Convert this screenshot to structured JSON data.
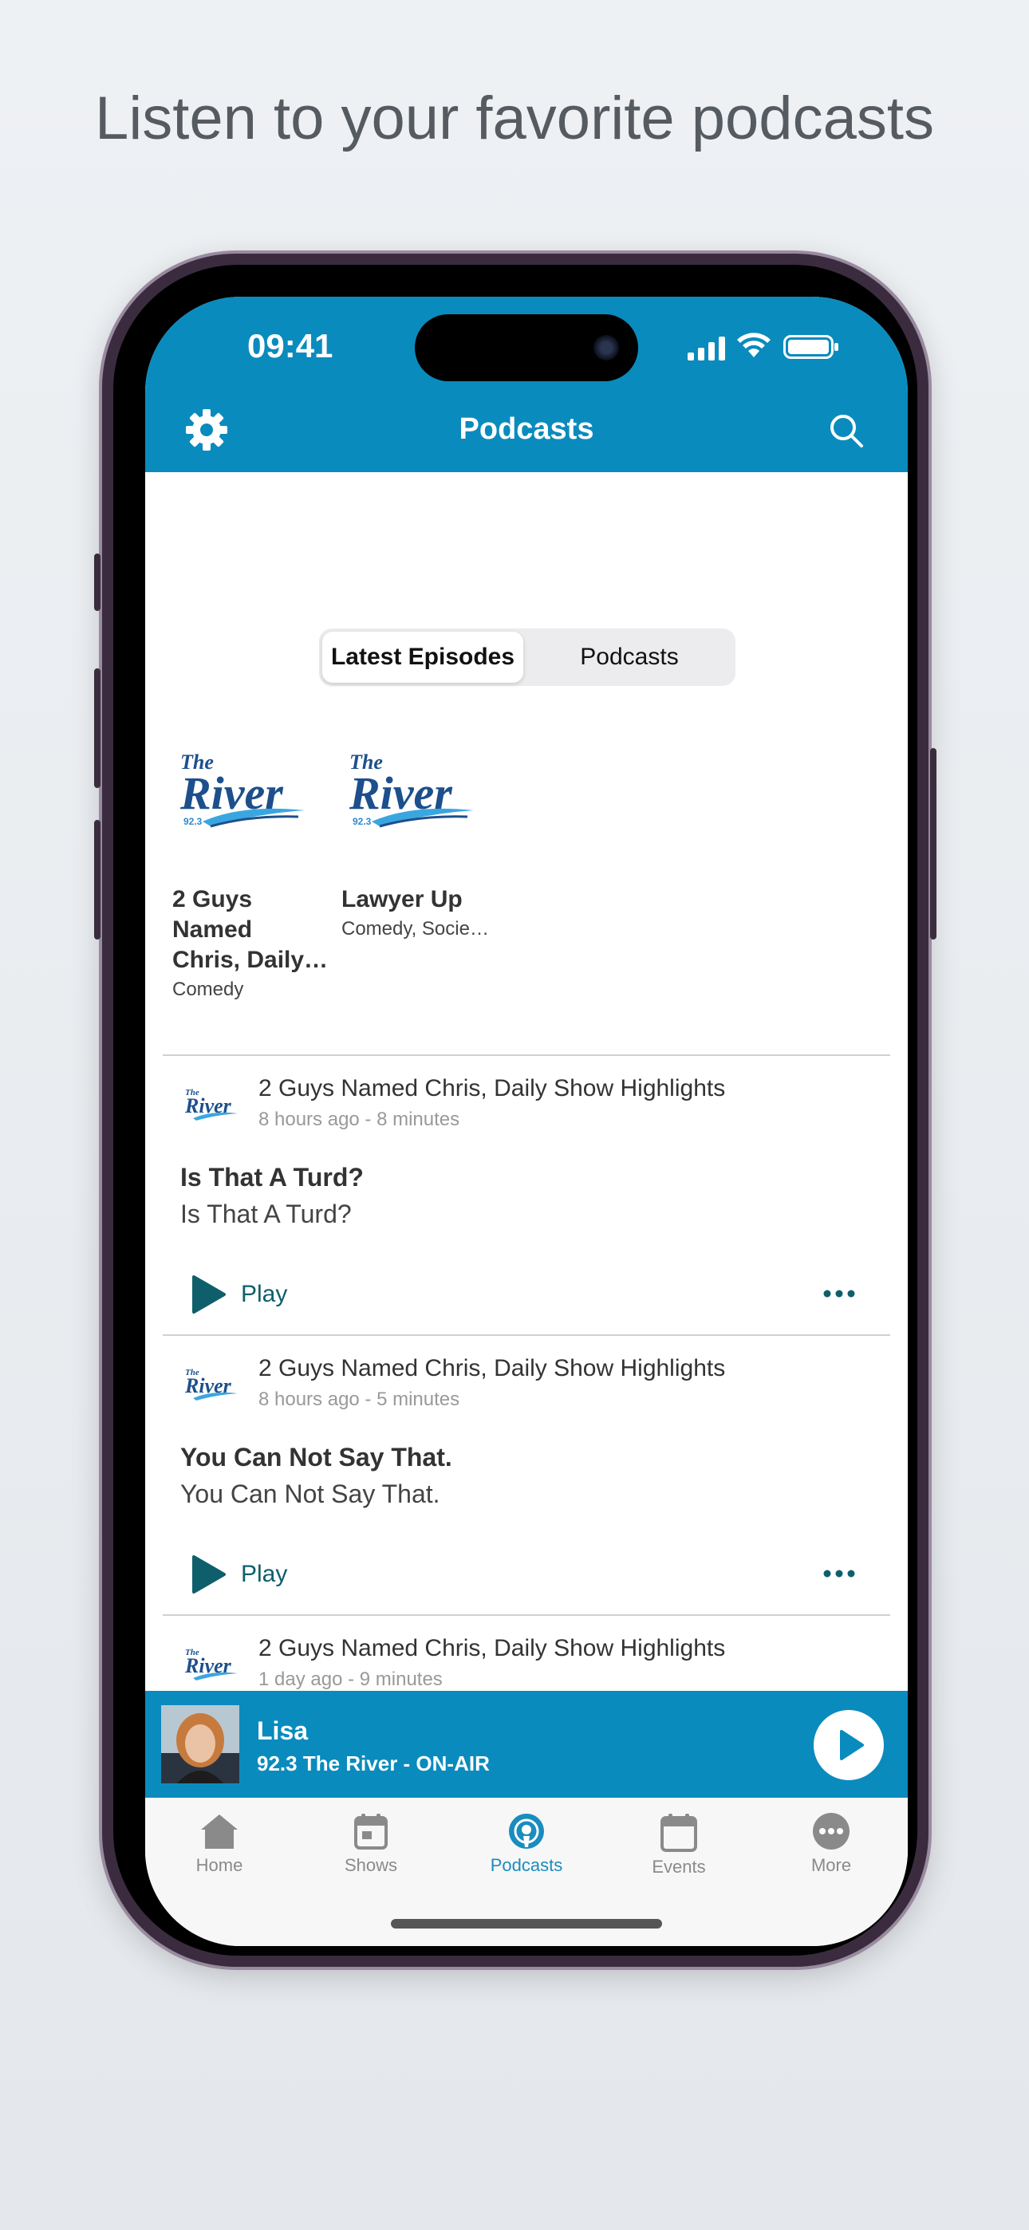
{
  "headline": "Listen to your favorite podcasts",
  "status_bar": {
    "time": "09:41"
  },
  "nav": {
    "title": "Podcasts",
    "settings_icon": "gear-icon",
    "search_icon": "search-icon"
  },
  "segmented": {
    "tabs": [
      "Latest Episodes",
      "Podcasts"
    ],
    "selected": "Latest Episodes"
  },
  "podcasts": [
    {
      "logo": "The River 92.3",
      "title_line1": "2 Guys Named",
      "title_line2": "Chris, Daily…",
      "category": "Comedy"
    },
    {
      "logo": "The River 92.3",
      "title_line1": "Lawyer Up",
      "title_line2": "",
      "category": "Comedy, Socie…"
    }
  ],
  "episodes": [
    {
      "show": "2 Guys Named Chris, Daily Show Highlights",
      "meta": "8 hours ago - 8 minutes",
      "title": "Is That A Turd?",
      "description": "Is That A Turd?",
      "play_label": "Play"
    },
    {
      "show": "2 Guys Named Chris, Daily Show Highlights",
      "meta": "8 hours ago - 5 minutes",
      "title": "You Can Not Say That.",
      "description": "You Can Not Say That.",
      "play_label": "Play"
    },
    {
      "show": "2 Guys Named Chris, Daily Show Highlights",
      "meta": "1 day ago - 9 minutes",
      "title": "",
      "description": "",
      "play_label": ""
    }
  ],
  "mini_player": {
    "name": "Lisa",
    "station": "92.3 The River - ON-AIR"
  },
  "tab_bar": {
    "tabs": [
      {
        "label": "Home",
        "icon": "home-icon"
      },
      {
        "label": "Shows",
        "icon": "calendar-icon"
      },
      {
        "label": "Podcasts",
        "icon": "podcast-icon"
      },
      {
        "label": "Events",
        "icon": "calendar-icon"
      },
      {
        "label": "More",
        "icon": "more-icon"
      }
    ],
    "active": "Podcasts"
  },
  "colors": {
    "brand": "#0a8bbd",
    "play_accent": "#0e5f6b",
    "active_tab": "#1a8cbf"
  }
}
